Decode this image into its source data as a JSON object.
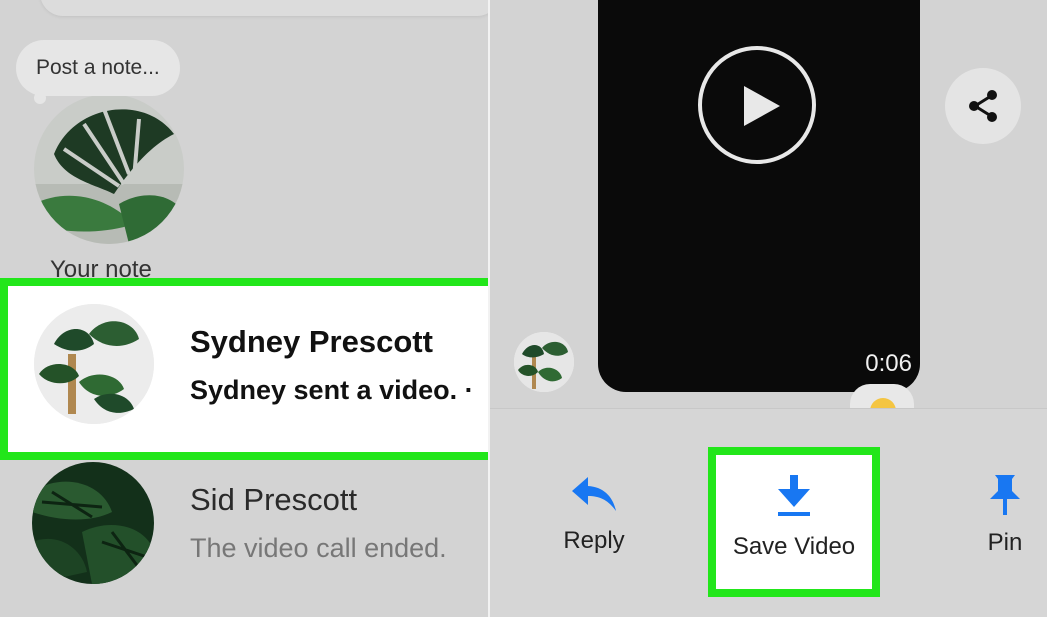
{
  "left": {
    "note_prompt": "Post a note...",
    "note_label": "Your note",
    "conversations": [
      {
        "name": "Sydney Prescott",
        "last_message": "Sydney sent a video. ·"
      },
      {
        "name": "Sid Prescott",
        "last_message": "The video call ended."
      }
    ]
  },
  "right": {
    "video_duration": "0:06",
    "actions": [
      {
        "label": "Reply",
        "icon": "reply-icon"
      },
      {
        "label": "Save Video",
        "icon": "download-icon"
      },
      {
        "label": "Pin",
        "icon": "pin-icon"
      }
    ],
    "share_icon": "share-icon",
    "play_icon": "play-icon"
  },
  "colors": {
    "highlight": "#22e61a",
    "accent": "#1877f2",
    "background": "#d3d3d3"
  }
}
